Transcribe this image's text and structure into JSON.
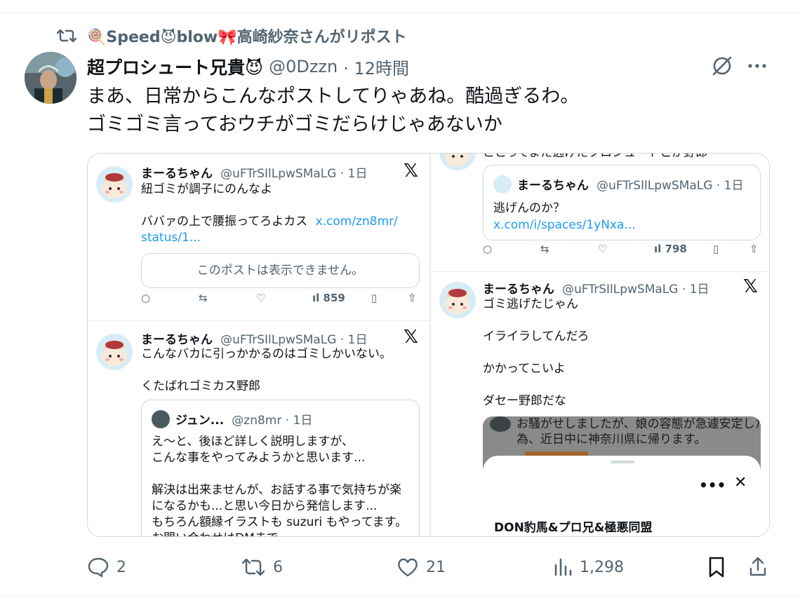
{
  "repost": {
    "text": "🍭Speed😈blow🎀高崎紗奈さんがリポスト"
  },
  "post": {
    "author_name": "超プロシュート兄貴😈",
    "handle": "@0Dzzn",
    "time": "· 12時間",
    "lines": [
      "まあ、日常からこんなポストしてりゃあね。酷過ぎるわ。",
      "ゴミゴミ言っておウチがゴミだらけじゃあないか"
    ]
  },
  "media": {
    "left_top": {
      "name": "まーるちゃん",
      "handle": "@uFTrSIlLpwSMaLG · 1日",
      "lines": [
        "紐ゴミが調子にのんなよ",
        "",
        "ババァの上で腰振ってろよカス"
      ],
      "link1": "x.com/zn8mr/",
      "link2": "status/1...",
      "unavailable": "このポストは表示できません。",
      "views": "859",
      "x_logo": "𝕏"
    },
    "left_bottom": {
      "name": "まーるちゃん",
      "handle": "@uFTrSIlLpwSMaLG · 1日",
      "line1": "こんなバカに引っかかるのはゴミしかいない。",
      "line2": "くたばれゴミカス野郎",
      "x_logo": "𝕏",
      "quote": {
        "name": "ジュン...",
        "handle": "@zn8mr · 1日",
        "lines": [
          "え〜と、後ほど詳しく説明しますが、",
          "こんな事をやってみようかと思います...",
          "",
          "解決は出来ませんが、お話する事で気持ちが楽",
          "になるかも...と思い今日から発信します...",
          "もちろん額縁イラストも suzuri もやってます。",
          "お問い合わせはDMまで"
        ]
      }
    },
    "right_top": {
      "cut_line": "ここってまた逃げたプロシュートとか野郎",
      "quote_name": "まーるちゃん",
      "quote_handle": "@uFTrSIlLpwSMaLG · 1日",
      "quote_text": "逃げんのか？",
      "quote_link": "x.com/i/spaces/1yNxa...",
      "views": "798"
    },
    "right_bottom": {
      "name": "まーるちゃん",
      "handle": "@uFTrSIlLpwSMaLG · 1日",
      "x_logo": "𝕏",
      "lines": [
        "ゴミ逃げたじゃん",
        "",
        "イライラしてんだろ",
        "",
        "かかってこいよ",
        "",
        "ダセー野郎だな"
      ],
      "overlay_text1": "お騒がせしましたが、娘の容態が急遽安定した",
      "overlay_text2": "為、近日中に神奈川県に帰ります。",
      "sheet_title": "DON豹馬&プロ兄&極悪同盟"
    }
  },
  "actions": {
    "replies": "2",
    "reposts": "6",
    "likes": "21",
    "views": "1,298"
  }
}
